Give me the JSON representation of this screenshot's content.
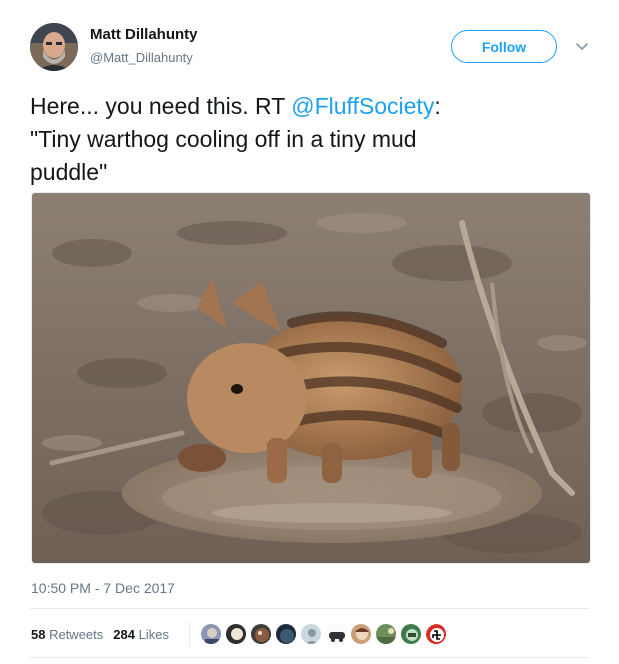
{
  "user": {
    "name": "Matt Dillahunty",
    "handle": "@Matt_Dillahunty"
  },
  "follow_button": {
    "label": "Follow"
  },
  "tweet": {
    "line1_prefix": "Here... you need this.  RT ",
    "mention": "@FluffSociety",
    "line1_suffix": ":",
    "line2": "\"Tiny warthog cooling off in a tiny mud",
    "line3": "puddle\""
  },
  "timestamp": "10:50 PM - 7 Dec 2017",
  "stats": {
    "retweets_count": "58",
    "retweets_label": " Retweets",
    "likes_count": "284",
    "likes_label": " Likes"
  },
  "colors": {
    "accent": "#1da1f2",
    "text": "#14171a",
    "muted": "#657786",
    "border": "#e6ecf0"
  },
  "icons": [
    "chevron-down-icon",
    "avatar",
    "liker-avatar"
  ]
}
